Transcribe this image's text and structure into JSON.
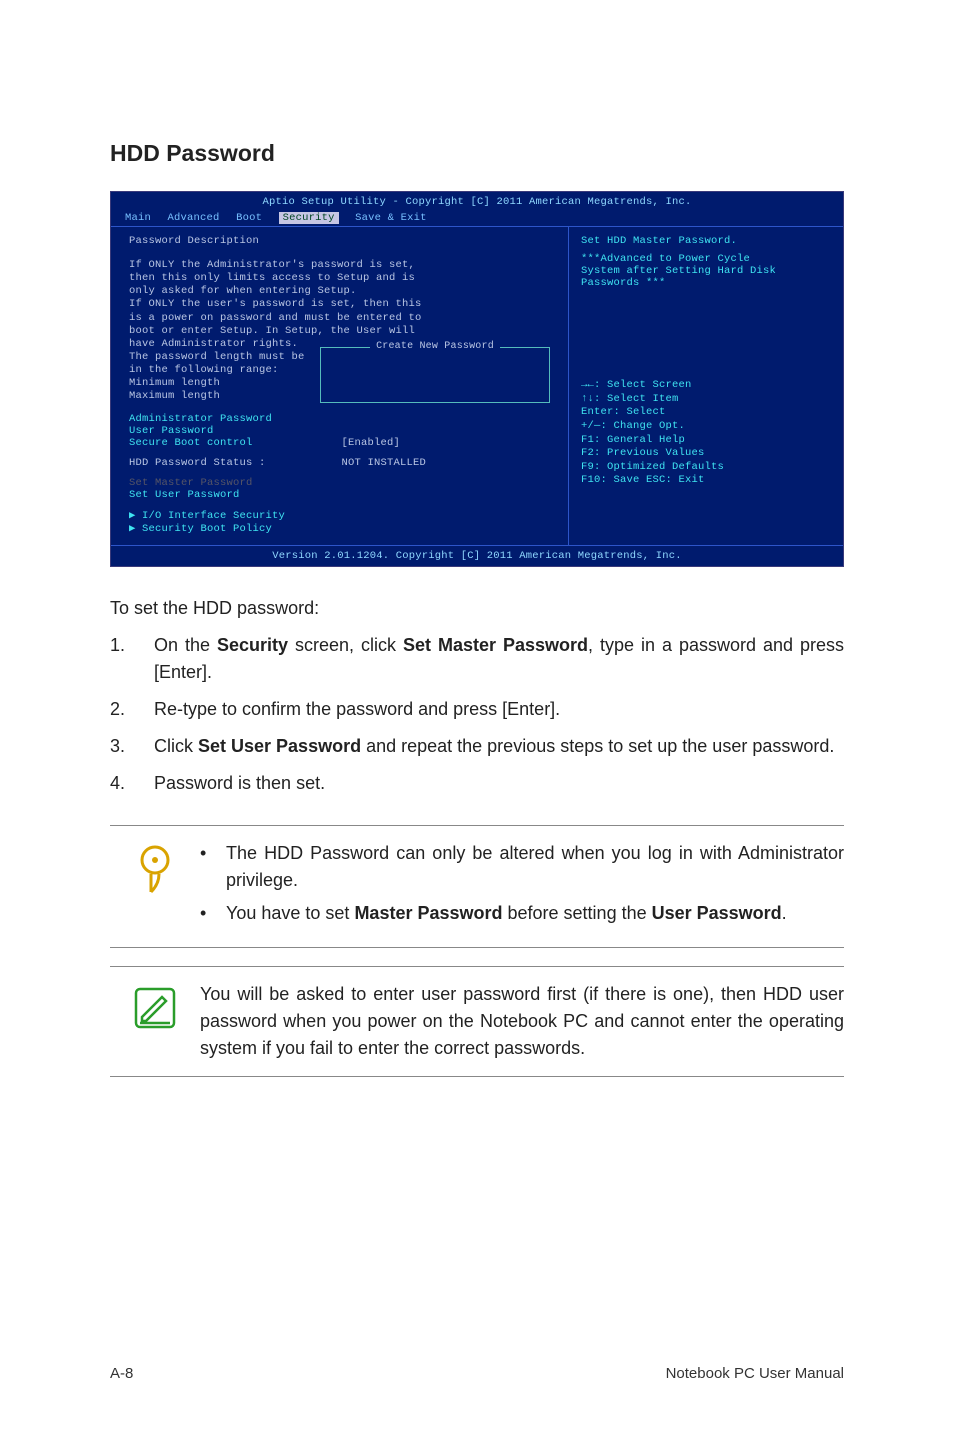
{
  "section_title": "HDD Password",
  "bios": {
    "top": "Aptio Setup Utility - Copyright [C] 2011 American Megatrends, Inc.",
    "tabs": {
      "main": "Main",
      "advanced": "Advanced",
      "boot": "Boot",
      "security": "Security",
      "save": "Save & Exit"
    },
    "left": {
      "header": "Password Description",
      "p1": "If ONLY the Administrator's password is set,",
      "p2": "then this only limits access to Setup and is",
      "p3": "only asked for when entering Setup.",
      "p4": "If ONLY the user's password is set, then this",
      "p5": "is a power on password and must be entered to",
      "p6": "boot or enter Setup. In Setup, the User will",
      "p7": "have Administrator rights.",
      "p8": "The password length must be",
      "p9": "in the following range:",
      "p10": "Minimum length",
      "p11": "Maximum length",
      "pw_label": "Create New Password",
      "admin": "Administrator Password",
      "user": "User Password",
      "secure": "Secure Boot control",
      "secure_val": "[Enabled]",
      "hdd": "HDD Password Status :",
      "hdd_val": "NOT INSTALLED",
      "set_master": "Set Master Password",
      "set_user": "Set User Password",
      "io": "I/O Interface Security",
      "policy": "Security Boot Policy"
    },
    "right": {
      "r1": "Set HDD Master Password.",
      "r2": "***Advanced to Power Cycle",
      "r3": "System after Setting Hard Disk",
      "r4": "Passwords ***",
      "h1": "→←: Select Screen",
      "h2": "↑↓:   Select Item",
      "h3": "Enter: Select",
      "h4": "+/—:  Change Opt.",
      "h5": "F1:   General Help",
      "h6": "F2:   Previous Values",
      "h7": "F9:   Optimized Defaults",
      "h8": "F10:  Save   ESC: Exit"
    },
    "bottom": "Version 2.01.1204. Copyright [C] 2011 American Megatrends, Inc."
  },
  "intro": "To set the HDD password:",
  "steps": {
    "s1_a": "On the ",
    "s1_b": "Security",
    "s1_c": " screen, click ",
    "s1_d": "Set Master Password",
    "s1_e": ", type in a password and press [Enter].",
    "s2": "Re-type to confirm the password and press [Enter].",
    "s3_a": "Click ",
    "s3_b": "Set User Password",
    "s3_c": " and repeat the previous steps to set up the user password.",
    "s4": "Password is then set."
  },
  "note1": {
    "li1": "The HDD Password can only be altered when you log in with Administrator privilege.",
    "li2_a": "You have to set ",
    "li2_b": "Master Password",
    "li2_c": " before setting the ",
    "li2_d": "User Password",
    "li2_e": "."
  },
  "note2": "You will be asked to enter user password first (if there is one), then HDD user password when you power on the Notebook PC and cannot enter the operating system if you fail to enter the correct passwords.",
  "footer": {
    "left": "A-8",
    "right": "Notebook PC User Manual"
  }
}
